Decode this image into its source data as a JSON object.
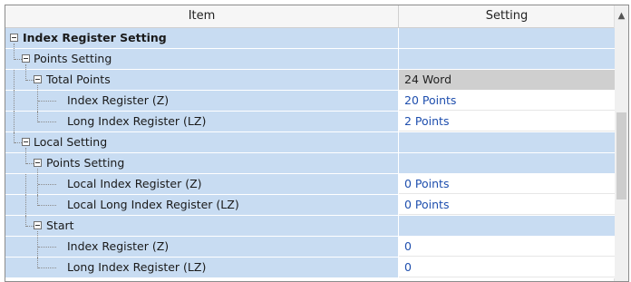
{
  "header": {
    "item": "Item",
    "setting": "Setting"
  },
  "rows": [
    {
      "label": "Index Register Setting",
      "value": ""
    },
    {
      "label": "Points Setting",
      "value": ""
    },
    {
      "label": "Total Points",
      "value": "24 Word"
    },
    {
      "label": "Index Register (Z)",
      "value": "20 Points"
    },
    {
      "label": "Long Index Register (LZ)",
      "value": "2 Points"
    },
    {
      "label": "Local Setting",
      "value": ""
    },
    {
      "label": "Points Setting",
      "value": ""
    },
    {
      "label": "Local Index Register (Z)",
      "value": "0 Points"
    },
    {
      "label": "Local Long Index Register (LZ)",
      "value": "0 Points"
    },
    {
      "label": "Start",
      "value": ""
    },
    {
      "label": "Index Register (Z)",
      "value": "0"
    },
    {
      "label": "Long Index Register (LZ)",
      "value": "0"
    }
  ],
  "colors": {
    "tree_background": "#c8dcf2",
    "value_text": "#1f4fae",
    "computed_cell": "#cfcfcf"
  },
  "icons": {
    "collapse": "minus-box-icon",
    "scroll_up": "up-arrow-icon"
  }
}
